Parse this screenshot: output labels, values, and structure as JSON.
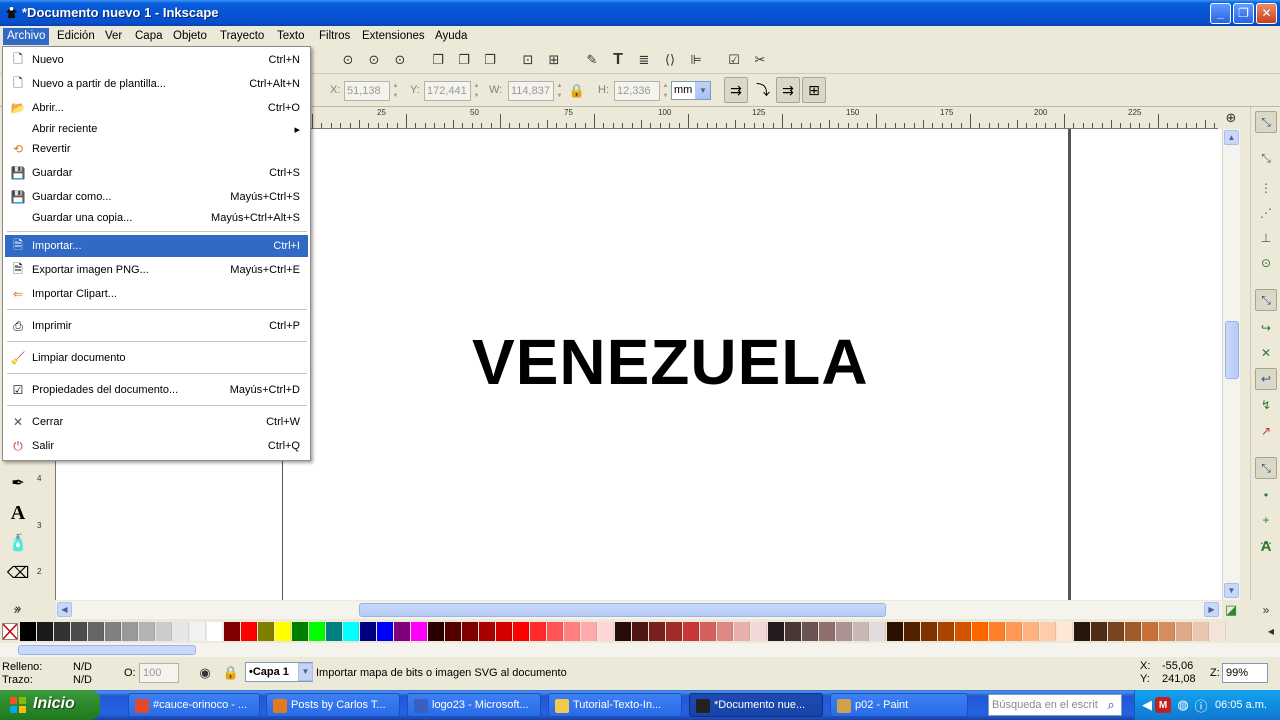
{
  "window": {
    "title": "*Documento nuevo 1 - Inkscape",
    "minimize": "_",
    "maximize": "❐",
    "close": "✕"
  },
  "menubar": [
    "Archivo",
    "Edición",
    "Ver",
    "Capa",
    "Objeto",
    "Trayecto",
    "Texto",
    "Filtros",
    "Extensiones",
    "Ayuda"
  ],
  "file_menu": {
    "items": [
      {
        "label": "Nuevo",
        "accel": "Ctrl+N",
        "icon": "new-document-icon"
      },
      {
        "label": "Nuevo a partir de plantilla...",
        "accel": "Ctrl+Alt+N",
        "icon": "template-icon"
      },
      {
        "label": "Abrir...",
        "accel": "Ctrl+O",
        "icon": "open-folder-icon"
      },
      {
        "label": "Abrir reciente",
        "accel": "",
        "submenu": "▸",
        "icon": ""
      },
      {
        "label": "Revertir",
        "accel": "",
        "icon": "revert-icon"
      },
      {
        "label": "Guardar",
        "accel": "Ctrl+S",
        "icon": "save-icon"
      },
      {
        "label": "Guardar como...",
        "accel": "Mayús+Ctrl+S",
        "icon": "save-as-icon"
      },
      {
        "label": "Guardar una copia...",
        "accel": "Mayús+Ctrl+Alt+S",
        "icon": ""
      },
      {
        "label": "Importar...",
        "accel": "Ctrl+I",
        "icon": "import-icon"
      },
      {
        "label": "Exportar imagen PNG...",
        "accel": "Mayús+Ctrl+E",
        "icon": "export-png-icon"
      },
      {
        "label": "Importar Clipart...",
        "accel": "",
        "icon": "clipart-icon"
      },
      {
        "label": "Imprimir",
        "accel": "Ctrl+P",
        "icon": "print-icon"
      },
      {
        "label": "Limpiar documento",
        "accel": "",
        "icon": "vacuum-icon"
      },
      {
        "label": "Propiedades del documento...",
        "accel": "Mayús+Ctrl+D",
        "icon": "document-properties-icon"
      },
      {
        "label": "Cerrar",
        "accel": "Ctrl+W",
        "icon": "close-icon"
      },
      {
        "label": "Salir",
        "accel": "Ctrl+Q",
        "icon": "quit-icon"
      }
    ]
  },
  "controls": {
    "x_label": "X:",
    "x_value": "51,138",
    "y_label": "Y:",
    "y_value": "172,441",
    "w_label": "W:",
    "w_value": "114,837",
    "h_label": "H:",
    "h_value": "12,336",
    "unit": "mm"
  },
  "ruler": {
    "top_numbers": [
      "25",
      "50",
      "75",
      "100",
      "125",
      "150",
      "175",
      "200",
      "225"
    ],
    "left_numbers": [
      "4",
      "3",
      "2"
    ]
  },
  "canvas": {
    "text": "VENEZUELA"
  },
  "status": {
    "fill_label": "Relleno:",
    "fill_value": "N/D",
    "stroke_label": "Trazo:",
    "stroke_value": "N/D",
    "opacity_label": "O:",
    "opacity_value": "100",
    "layer": "•Capa 1",
    "message": "Importar mapa de bits o imagen SVG al documento",
    "cursor_x_label": "X:",
    "cursor_x": "-55,06",
    "cursor_y_label": "Y:",
    "cursor_y": "241,08",
    "zoom_label": "Z:",
    "zoom": "99%"
  },
  "palette_colors": [
    "#000000",
    "#1a1a1a",
    "#333333",
    "#4d4d4d",
    "#666666",
    "#808080",
    "#999999",
    "#b3b3b3",
    "#cccccc",
    "#e6e6e6",
    "#f2f2f2",
    "#ffffff",
    "#800000",
    "#ff0000",
    "#808000",
    "#ffff00",
    "#008000",
    "#00ff00",
    "#008080",
    "#00ffff",
    "#000080",
    "#0000ff",
    "#800080",
    "#ff00ff",
    "#2b0000",
    "#550000",
    "#800000",
    "#aa0000",
    "#d40000",
    "#ff0000",
    "#ff2a2a",
    "#ff5555",
    "#ff8080",
    "#ffaaaa",
    "#ffd5d5",
    "#280b0b",
    "#501616",
    "#782121",
    "#a02c2c",
    "#c83737",
    "#d35f5f",
    "#de8787",
    "#e9afaf",
    "#f4d7d7",
    "#241c1c",
    "#483737",
    "#6c5353",
    "#916f6f",
    "#ac9393",
    "#c8b7b7",
    "#e3dbdb",
    "#2b1100",
    "#552200",
    "#803300",
    "#aa4400",
    "#d45500",
    "#ff6600",
    "#ff7f2a",
    "#ff9955",
    "#ffb380",
    "#ffccaa",
    "#ffe6d5",
    "#28170b",
    "#502d16",
    "#784421",
    "#a05a2c",
    "#c87137",
    "#d38d5f",
    "#deaa87",
    "#e9c6af",
    "#f4e3d7"
  ],
  "taskbar": {
    "start_label": "Inicio",
    "tasks": [
      {
        "label": "#cauce-orinoco - ...",
        "color": "#e24a2e"
      },
      {
        "label": "Posts by Carlos T...",
        "color": "#e27a1f"
      },
      {
        "label": "logo23 - Microsoft...",
        "color": "#3a5fc0"
      },
      {
        "label": "Tutorial-Texto-In...",
        "color": "#f2c94c"
      },
      {
        "label": "*Documento nue...",
        "color": "#222222"
      },
      {
        "label": "p02 - Paint",
        "color": "#d0a04a"
      }
    ],
    "search_placeholder": "Búsqueda en el escrit",
    "clock": "06:05 a.m."
  }
}
